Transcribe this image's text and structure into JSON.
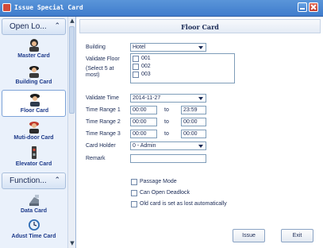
{
  "window": {
    "title": "Issue Special Card"
  },
  "sidebar": {
    "section1": {
      "label": "Open Lo..."
    },
    "section2": {
      "label": "Function..."
    },
    "items": [
      {
        "label": "Master Card",
        "icon": "master-card-icon"
      },
      {
        "label": "Building Card",
        "icon": "building-card-icon"
      },
      {
        "label": "Floor Card",
        "icon": "floor-card-icon"
      },
      {
        "label": "Muti-door Card",
        "icon": "multi-door-card-icon"
      },
      {
        "label": "Elevator Card",
        "icon": "elevator-card-icon"
      },
      {
        "label": "Data Card",
        "icon": "data-card-icon"
      },
      {
        "label": "Adust Time Card",
        "icon": "adjust-time-card-icon"
      }
    ]
  },
  "panel": {
    "title": "Floor Card"
  },
  "form": {
    "building_label": "Building",
    "building_value": "Hotel",
    "validate_floor_label": "Validate Floor",
    "validate_floor_hint": "(Select 5 at most)",
    "floors": [
      "001",
      "002",
      "003"
    ],
    "validate_time_label": "Validate Time",
    "validate_time_value": "2014-11-27",
    "time_ranges": [
      {
        "label": "Time Range 1",
        "from": "00:00",
        "to": "23:59"
      },
      {
        "label": "Time Range 2",
        "from": "00:00",
        "to": "00:00"
      },
      {
        "label": "Time Range 3",
        "from": "00:00",
        "to": "00:00"
      }
    ],
    "to_label": "to",
    "card_holder_label": "Card Holder",
    "card_holder_value": "0 - Admin",
    "remark_label": "Remark",
    "remark_value": "",
    "options": [
      "Passage Mode",
      "Can Open Deadlock",
      "Old card is set as lost automatically"
    ]
  },
  "buttons": {
    "issue": "Issue",
    "exit": "Exit"
  },
  "colors": {
    "titlebar": "#4a86d3",
    "accent": "#1d3a8a",
    "selected_border": "#7ea4d8"
  }
}
